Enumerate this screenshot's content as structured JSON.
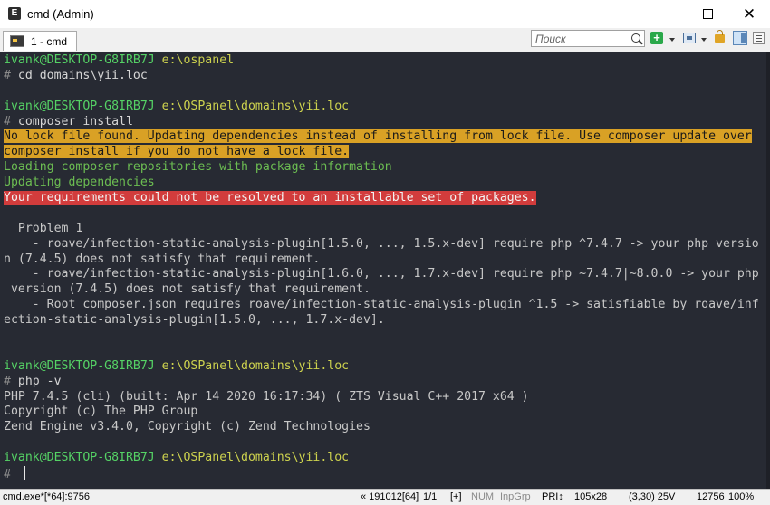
{
  "window": {
    "title": "cmd (Admin)",
    "icon_letter": "E"
  },
  "tabs": [
    {
      "label": "1 - cmd"
    }
  ],
  "search": {
    "placeholder": "Поиск"
  },
  "colors": {
    "terminal_bg": "#272a33",
    "prompt_green": "#55d265",
    "path_yellow": "#cdd24e",
    "warning_bg": "#d9a125",
    "error_bg": "#d23c3c",
    "info_green": "#6cbd52"
  },
  "terminal": {
    "lines": [
      {
        "segments": [
          {
            "text": "ivank@DESKTOP-G8IRB7J",
            "style": "prompt"
          },
          {
            "text": " e:\\ospanel",
            "style": "path"
          }
        ]
      },
      {
        "segments": [
          {
            "text": "# ",
            "style": "hash"
          },
          {
            "text": "cd domains\\yii.loc",
            "style": "cmd"
          }
        ]
      },
      {
        "segments": []
      },
      {
        "segments": [
          {
            "text": "ivank@DESKTOP-G8IRB7J",
            "style": "prompt"
          },
          {
            "text": " e:\\OSPanel\\domains\\yii.loc",
            "style": "path"
          }
        ]
      },
      {
        "segments": [
          {
            "text": "# ",
            "style": "hash"
          },
          {
            "text": "composer install",
            "style": "cmd"
          }
        ]
      },
      {
        "segments": [
          {
            "text": "No lock file found. Updating dependencies instead of installing from lock file. Use composer update over",
            "style": "warn"
          }
        ]
      },
      {
        "segments": [
          {
            "text": "composer install if you do not have a lock file.",
            "style": "warn"
          }
        ]
      },
      {
        "segments": [
          {
            "text": "Loading composer repositories with package information",
            "style": "info"
          }
        ]
      },
      {
        "segments": [
          {
            "text": "Updating dependencies",
            "style": "info"
          }
        ]
      },
      {
        "segments": [
          {
            "text": "Your requirements could not be resolved to an installable set of packages.",
            "style": "error"
          }
        ]
      },
      {
        "segments": []
      },
      {
        "segments": [
          {
            "text": "  Problem 1",
            "style": "out"
          }
        ]
      },
      {
        "segments": [
          {
            "text": "    - roave/infection-static-analysis-plugin[1.5.0, ..., 1.5.x-dev] require php ^7.4.7 -> your php versio",
            "style": "out"
          }
        ]
      },
      {
        "segments": [
          {
            "text": "n (7.4.5) does not satisfy that requirement.",
            "style": "out"
          }
        ]
      },
      {
        "segments": [
          {
            "text": "    - roave/infection-static-analysis-plugin[1.6.0, ..., 1.7.x-dev] require php ~7.4.7|~8.0.0 -> your php",
            "style": "out"
          }
        ]
      },
      {
        "segments": [
          {
            "text": " version (7.4.5) does not satisfy that requirement.",
            "style": "out"
          }
        ]
      },
      {
        "segments": [
          {
            "text": "    - Root composer.json requires roave/infection-static-analysis-plugin ^1.5 -> satisfiable by roave/inf",
            "style": "out"
          }
        ]
      },
      {
        "segments": [
          {
            "text": "ection-static-analysis-plugin[1.5.0, ..., 1.7.x-dev].",
            "style": "out"
          }
        ]
      },
      {
        "segments": []
      },
      {
        "segments": []
      },
      {
        "segments": [
          {
            "text": "ivank@DESKTOP-G8IRB7J",
            "style": "prompt"
          },
          {
            "text": " e:\\OSPanel\\domains\\yii.loc",
            "style": "path"
          }
        ]
      },
      {
        "segments": [
          {
            "text": "# ",
            "style": "hash"
          },
          {
            "text": "php -v",
            "style": "cmd"
          }
        ]
      },
      {
        "segments": [
          {
            "text": "PHP 7.4.5 (cli) (built: Apr 14 2020 16:17:34) ( ZTS Visual C++ 2017 x64 )",
            "style": "out"
          }
        ]
      },
      {
        "segments": [
          {
            "text": "Copyright (c) The PHP Group",
            "style": "out"
          }
        ]
      },
      {
        "segments": [
          {
            "text": "Zend Engine v3.4.0, Copyright (c) Zend Technologies",
            "style": "out"
          }
        ]
      },
      {
        "segments": []
      },
      {
        "segments": [
          {
            "text": "ivank@DESKTOP-G8IRB7J",
            "style": "prompt"
          },
          {
            "text": " e:\\OSPanel\\domains\\yii.loc",
            "style": "path"
          }
        ]
      },
      {
        "segments": [
          {
            "text": "# ",
            "style": "hash"
          }
        ],
        "cursor": true
      }
    ]
  },
  "statusbar": {
    "process": "cmd.exe*[*64]:9756",
    "build": "« 191012[64]",
    "console_index": "1/1",
    "plus": "[+]",
    "num": "NUM",
    "inp_grp": "InpGrp",
    "pri": "PRI↕",
    "size": "105x28",
    "cursor_pos": "(3,30) 25V",
    "pid": "12756",
    "zoom": "100%"
  }
}
